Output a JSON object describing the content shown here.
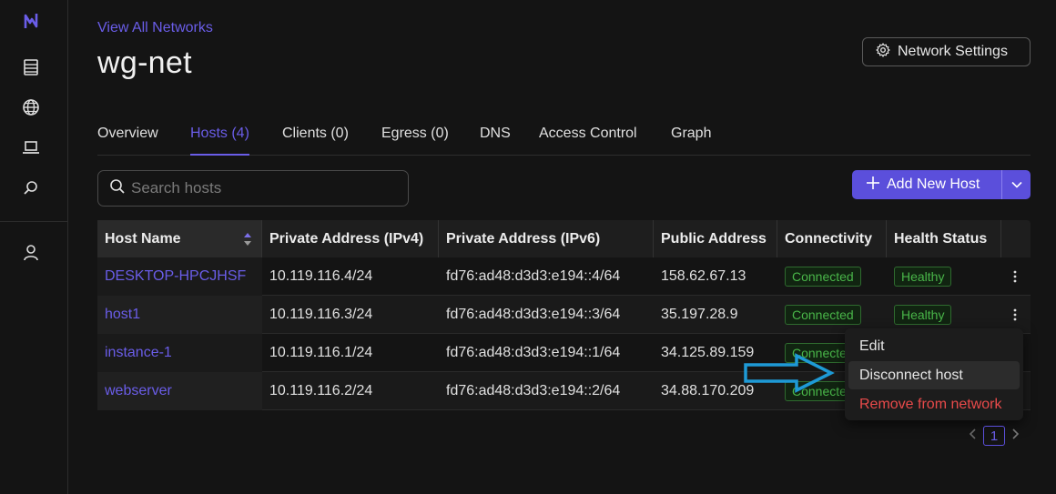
{
  "sidebar": {
    "items": [
      {
        "name": "logo-icon"
      },
      {
        "name": "nodes-icon"
      },
      {
        "name": "globe-icon"
      },
      {
        "name": "laptop-icon"
      },
      {
        "name": "search-icon"
      },
      {
        "name": "user-icon"
      }
    ]
  },
  "header": {
    "back_link": "View All Networks",
    "title": "wg-net",
    "settings_label": "Network Settings"
  },
  "tabs": [
    {
      "label": "Overview"
    },
    {
      "label": "Hosts (4)"
    },
    {
      "label": "Clients (0)"
    },
    {
      "label": "Egress (0)"
    },
    {
      "label": "DNS"
    },
    {
      "label": "Access Control"
    },
    {
      "label": "Graph"
    }
  ],
  "search": {
    "placeholder": "Search hosts"
  },
  "add_button": {
    "label": "Add New Host"
  },
  "table": {
    "headers": [
      "Host Name",
      "Private Address (IPv4)",
      "Private Address (IPv6)",
      "Public Address",
      "Connectivity",
      "Health Status"
    ],
    "rows": [
      {
        "host": "DESKTOP-HPCJHSF",
        "ipv4": "10.119.116.4/24",
        "ipv6": "fd76:ad48:d3d3:e194::4/64",
        "public": "158.62.67.13",
        "connectivity": "Connected",
        "health": "Healthy"
      },
      {
        "host": "host1",
        "ipv4": "10.119.116.3/24",
        "ipv6": "fd76:ad48:d3d3:e194::3/64",
        "public": "35.197.28.9",
        "connectivity": "Connected",
        "health": "Healthy"
      },
      {
        "host": "instance-1",
        "ipv4": "10.119.116.1/24",
        "ipv6": "fd76:ad48:d3d3:e194::1/64",
        "public": "34.125.89.159",
        "connectivity": "Connected",
        "health": ""
      },
      {
        "host": "webserver",
        "ipv4": "10.119.116.2/24",
        "ipv6": "fd76:ad48:d3d3:e194::2/64",
        "public": "34.88.170.209",
        "connectivity": "Connected",
        "health": ""
      }
    ]
  },
  "context_menu": {
    "items": [
      {
        "label": "Edit"
      },
      {
        "label": "Disconnect host"
      },
      {
        "label": "Remove from network"
      }
    ]
  },
  "pagination": {
    "current": "1"
  },
  "colors": {
    "accent": "#5b4fdb",
    "link": "#6a5de8",
    "success": "#49b649",
    "danger": "#e84a4a",
    "annotation_arrow": "#1e9ad6"
  }
}
